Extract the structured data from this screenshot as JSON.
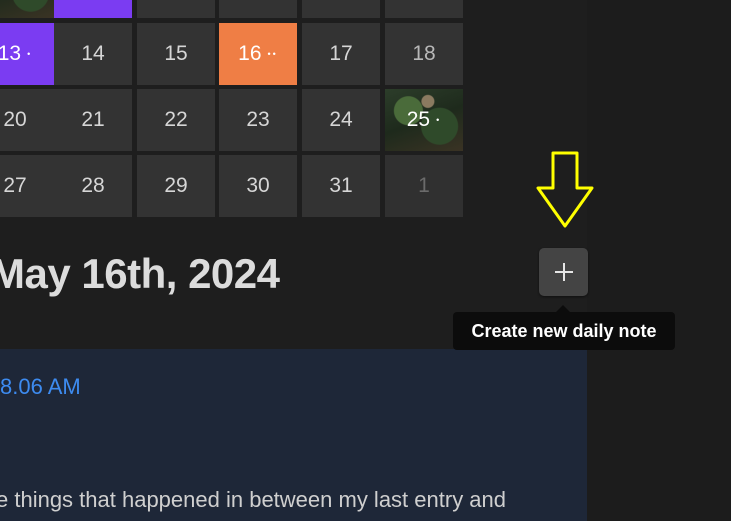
{
  "calendar": {
    "rows": [
      [
        {
          "label": "",
          "style": "photo"
        },
        {
          "label": "",
          "style": "purple"
        },
        {
          "label": "",
          "style": "normal"
        },
        {
          "label": "",
          "style": "normal"
        },
        {
          "label": "",
          "style": "normal"
        },
        {
          "label": "",
          "style": "normal"
        }
      ],
      [
        {
          "label": "13",
          "style": "purple",
          "dots": "•"
        },
        {
          "label": "14",
          "style": "normal"
        },
        {
          "label": "15",
          "style": "normal"
        },
        {
          "label": "16",
          "style": "orange",
          "dots": "••"
        },
        {
          "label": "17",
          "style": "normal"
        },
        {
          "label": "18",
          "style": "light"
        }
      ],
      [
        {
          "label": "20",
          "style": "normal"
        },
        {
          "label": "21",
          "style": "normal"
        },
        {
          "label": "22",
          "style": "normal"
        },
        {
          "label": "23",
          "style": "normal"
        },
        {
          "label": "24",
          "style": "normal"
        },
        {
          "label": "25",
          "style": "photo",
          "dots": "•"
        }
      ],
      [
        {
          "label": "27",
          "style": "normal"
        },
        {
          "label": "28",
          "style": "normal"
        },
        {
          "label": "29",
          "style": "normal"
        },
        {
          "label": "30",
          "style": "normal"
        },
        {
          "label": "31",
          "style": "normal"
        },
        {
          "label": "1",
          "style": "dim"
        }
      ]
    ]
  },
  "daily_note": {
    "title": "May 16th, 2024",
    "entry_time": "8.06 AM",
    "entry_excerpt": "e things that happened in between my last entry and"
  },
  "actions": {
    "add_icon": "plus-icon",
    "tooltip": "Create new daily note"
  },
  "annotation": {
    "icon": "arrow-down-icon",
    "color": "#ffff00"
  },
  "colors": {
    "purple": "#7b3cf2",
    "orange": "#ef7e45",
    "accent_blue": "#3d8bf0",
    "note_bg": "#1e2738"
  }
}
